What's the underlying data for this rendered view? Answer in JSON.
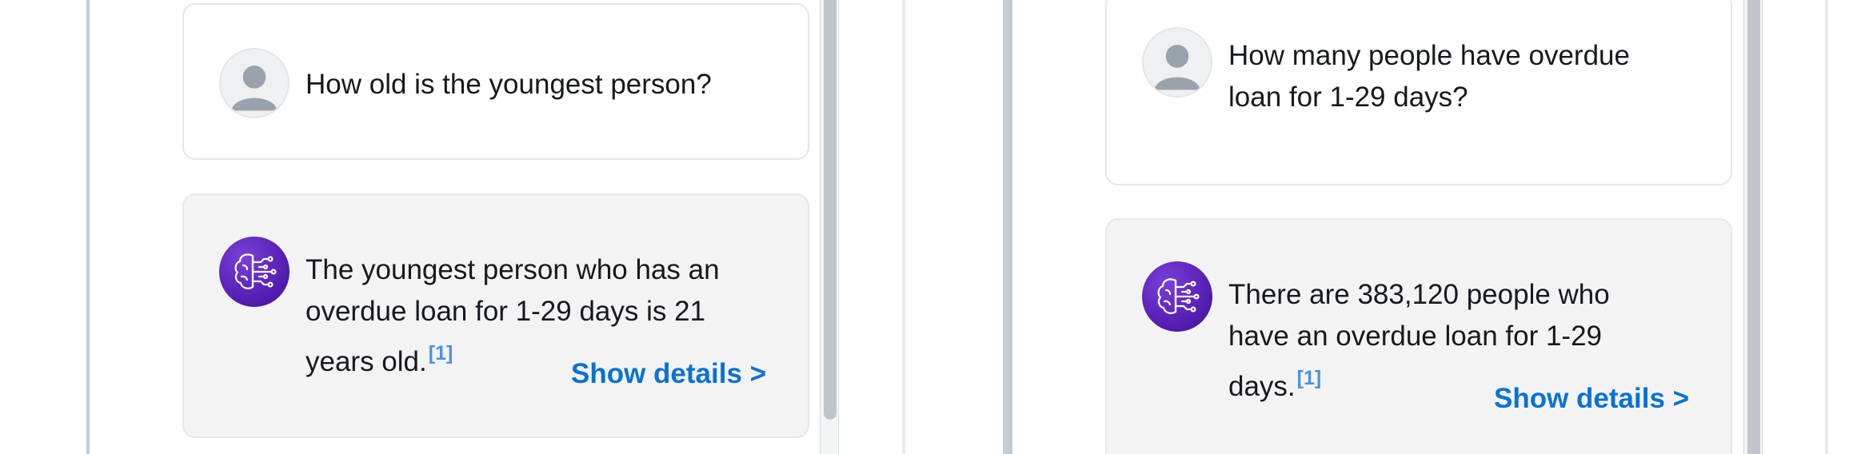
{
  "left_panel": {
    "question": "How old is the youngest person?",
    "answer": "The youngest person who has an\noverdue loan for 1-29 days is 21\nyears old.",
    "citation": "[1]",
    "show_details": "Show details >"
  },
  "right_panel": {
    "question": "How many people have overdue\nloan for 1-29 days?",
    "answer": "There are 383,120 people who\nhave an overdue loan for 1-29\ndays.",
    "citation": "[1]",
    "show_details": "Show details >"
  },
  "icons": {
    "user_avatar": "user-avatar-icon",
    "assistant_avatar": "ai-brain-circuit-icon"
  },
  "colors": {
    "link": "#0972d3",
    "citation": "#4b91e2",
    "assistant_avatar": "#5a22b8"
  }
}
